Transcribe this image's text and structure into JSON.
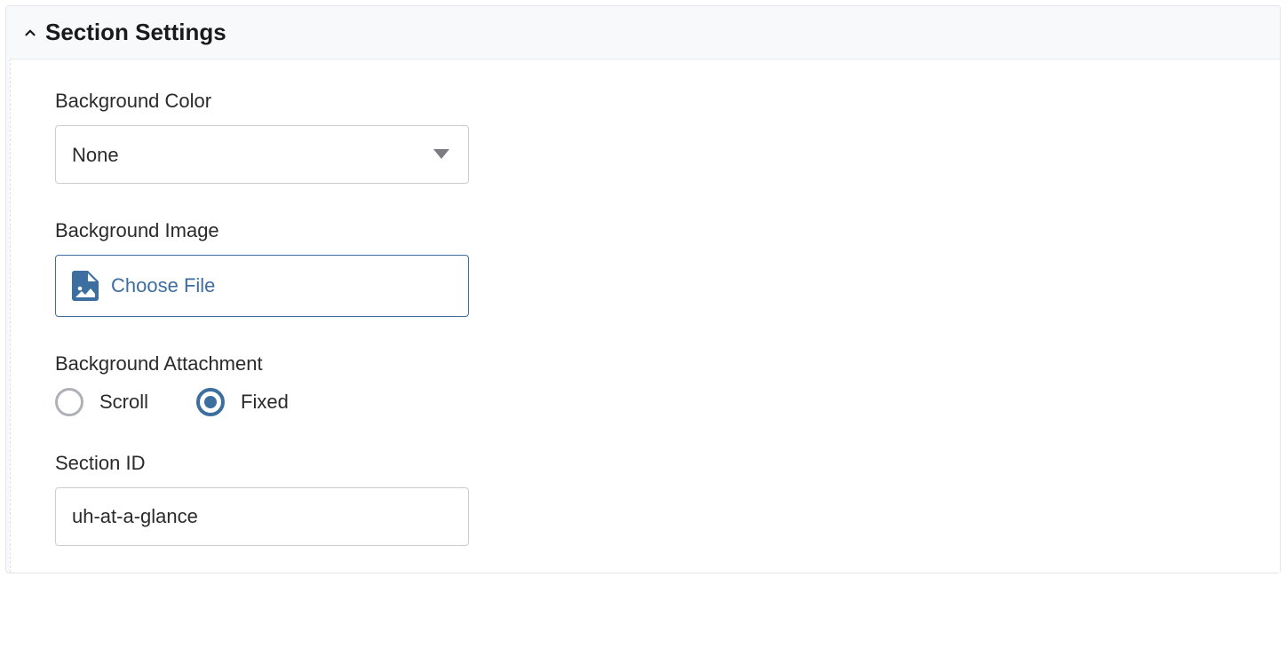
{
  "panel": {
    "title": "Section Settings"
  },
  "fields": {
    "backgroundColor": {
      "label": "Background Color",
      "selected": "None"
    },
    "backgroundImage": {
      "label": "Background Image",
      "button": "Choose File"
    },
    "backgroundAttachment": {
      "label": "Background Attachment",
      "options": {
        "scroll": "Scroll",
        "fixed": "Fixed"
      },
      "selected": "fixed"
    },
    "sectionId": {
      "label": "Section ID",
      "value": "uh-at-a-glance"
    }
  }
}
